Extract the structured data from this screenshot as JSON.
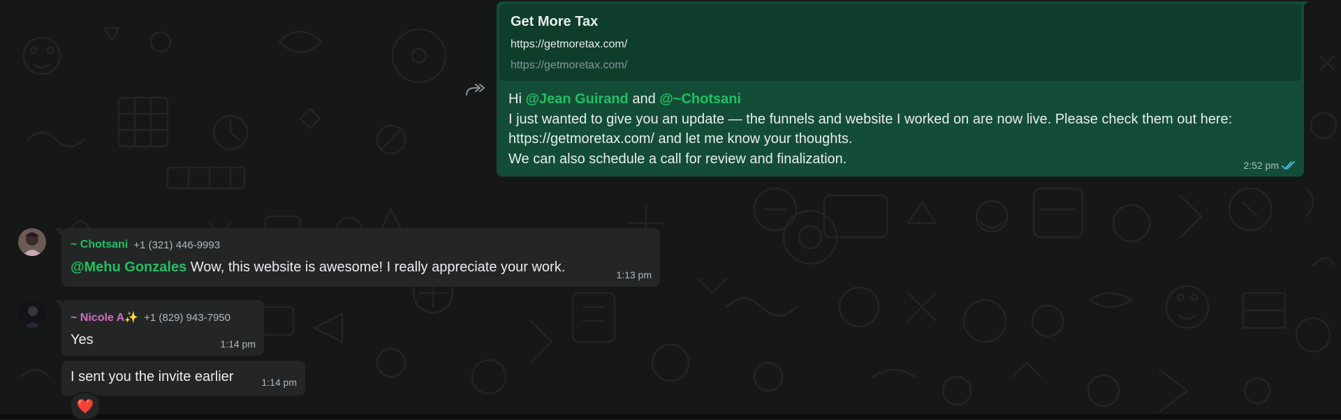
{
  "outgoing": {
    "link_preview": {
      "title": "Get More Tax",
      "description": "https://getmoretax.com/",
      "domain": "https://getmoretax.com/"
    },
    "greeting": "Hi ",
    "mention_1": "@Jean Guirand",
    "conj": " and ",
    "mention_2": "@~Chotsani",
    "line2": "I just wanted to give you an update — the funnels and website I worked on are now live. Please check them out here:",
    "line3": "https://getmoretax.com/ and let me know your thoughts.",
    "line4": "We can also schedule a call for review and finalization.",
    "time": "2:52 pm",
    "status_icon": "double-check-read-icon"
  },
  "messages": [
    {
      "sender": "~ Chotsani",
      "phone": "+1 (321) 446-9993",
      "mention": "@Mehu Gonzales",
      "text": " Wow, this website is awesome! I really appreciate your work.",
      "time": "1:13 pm",
      "name_color": "#21c063"
    },
    {
      "sender": "~ Nicole A",
      "sender_emoji": "✨",
      "phone": "+1 (829) 943-7950",
      "text": "Yes",
      "time": "1:14 pm",
      "name_color": "#d36fc4"
    },
    {
      "text": "I sent you the invite earlier",
      "time": "1:14 pm",
      "reaction": "❤️"
    }
  ],
  "colors": {
    "background": "#161717",
    "outgoing_bubble": "#144d37",
    "incoming_bubble": "#242626",
    "mention": "#21c063",
    "read_ticks": "#53bdeb"
  }
}
